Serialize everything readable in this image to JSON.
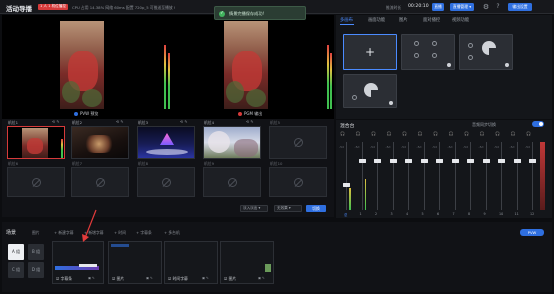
{
  "topbar": {
    "app_title": "活动导播",
    "badge": "1 人 1 机位播控",
    "sysinfo": "CPU 占用 14.38%   网络 60ms   配置 720p_5   可推送至播放 !",
    "timer_label": "推流时长",
    "timer": "00:20:10",
    "live_label": "直播",
    "manage_label": "直播管理 ▾",
    "output_label": "输出设置"
  },
  "toast": {
    "text": "情景完播保存成功!"
  },
  "monitor": {
    "preview_label": "PVW 预览",
    "program_label": "PGM 输出"
  },
  "scenes": {
    "tiles": [
      {
        "label": "机位1"
      },
      {
        "label": "机位2"
      },
      {
        "label": "机位3"
      },
      {
        "label": "机位4"
      },
      {
        "label": "机位5"
      },
      {
        "label": "机位6"
      },
      {
        "label": "机位7"
      },
      {
        "label": "机位8"
      },
      {
        "label": "机位9"
      },
      {
        "label": "机位10"
      }
    ],
    "transition_select": "淡入淡出",
    "duration_select": "无效果",
    "fade_button": "切换"
  },
  "right_panel": {
    "tabs": [
      "多画布",
      "画面功能",
      "图片",
      "面对播控",
      "视频功能"
    ]
  },
  "mixer": {
    "title": "混合台",
    "sync_label": "音频同步切换",
    "channels": [
      {
        "name": "总",
        "level": 0.4,
        "vu": 0.32
      },
      {
        "name": "1",
        "level": 0.75,
        "vu": 0.45
      },
      {
        "name": "2",
        "level": 0.75,
        "vu": 0
      },
      {
        "name": "3",
        "level": 0.75,
        "vu": 0
      },
      {
        "name": "4",
        "level": 0.75,
        "vu": 0
      },
      {
        "name": "5",
        "level": 0.75,
        "vu": 0
      },
      {
        "name": "6",
        "level": 0.75,
        "vu": 0
      },
      {
        "name": "7",
        "level": 0.75,
        "vu": 0
      },
      {
        "name": "8",
        "level": 0.75,
        "vu": 0
      },
      {
        "name": "9",
        "level": 0.75,
        "vu": 0
      },
      {
        "name": "10",
        "level": 0.75,
        "vu": 0
      },
      {
        "name": "11",
        "level": 0.75,
        "vu": 0
      },
      {
        "name": "12",
        "level": 0.75,
        "vu": 0
      }
    ]
  },
  "bottom": {
    "title": "场景",
    "tabs": [
      "图片",
      "+ 新建字幕",
      "+ 新增字幕",
      "+ 时间",
      "+ 字幕条",
      "+ 多台机"
    ],
    "fade_button": "PVW",
    "banks": [
      "A 组",
      "B 组",
      "C 组",
      "D 组"
    ],
    "subtitles": [
      {
        "name": "字幕条"
      },
      {
        "name": "图片"
      },
      {
        "name": "时间字幕"
      },
      {
        "name": "图片"
      }
    ]
  },
  "colors": {
    "accent": "#2f6fe0",
    "live": "#d63a3a",
    "success": "#41b35e"
  }
}
